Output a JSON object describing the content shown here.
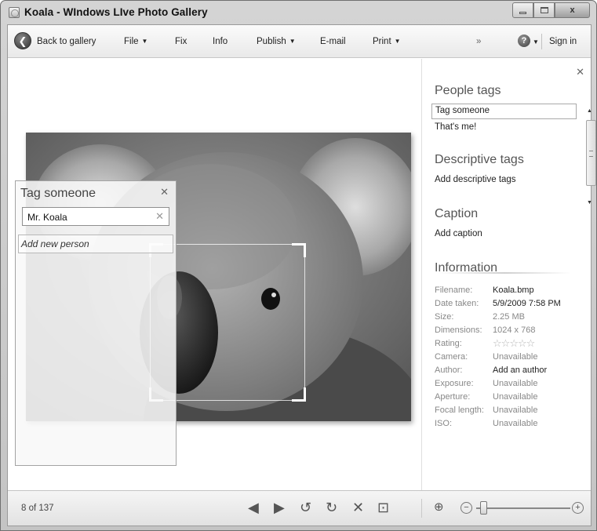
{
  "window": {
    "title": "Koala - WIndows LIve Photo Gallery",
    "controls": {
      "minimize": "",
      "maximize": "",
      "close": "x"
    }
  },
  "toolbar": {
    "back": "Back to gallery",
    "file": "File",
    "fix": "Fix",
    "info": "Info",
    "publish": "Publish",
    "email": "E-mail",
    "print": "Print",
    "more": "»",
    "help_icon": "help-icon",
    "sign_in": "Sign in"
  },
  "tag_popup": {
    "title": "Tag someone",
    "input_value": "Mr. Koala",
    "suggestion": "Add new person"
  },
  "side_pane": {
    "people_tags": {
      "title": "People tags",
      "field": "Tag someone",
      "thats_me": "That's me!"
    },
    "descriptive_tags": {
      "title": "Descriptive tags",
      "add": "Add descriptive tags"
    },
    "caption": {
      "title": "Caption",
      "add": "Add caption"
    },
    "information": {
      "title": "Information",
      "rows": [
        {
          "label": "Filename:",
          "value": "Koala.bmp",
          "strong": true
        },
        {
          "label": "Date taken:",
          "value": "5/9/2009 7:58 PM",
          "strong": true
        },
        {
          "label": "Size:",
          "value": "2.25 MB"
        },
        {
          "label": "Dimensions:",
          "value": "1024 x 768"
        },
        {
          "label": "Rating:",
          "value": ""
        },
        {
          "label": "Camera:",
          "value": "Unavailable"
        },
        {
          "label": "Author:",
          "value": "Add an author",
          "strong": true
        },
        {
          "label": "Exposure:",
          "value": "Unavailable"
        },
        {
          "label": "Aperture:",
          "value": "Unavailable"
        },
        {
          "label": "Focal length:",
          "value": "Unavailable"
        },
        {
          "label": "ISO:",
          "value": "Unavailable"
        }
      ],
      "rating_stars": 0
    }
  },
  "bottombar": {
    "counter": "8 of 137",
    "zoom_level": 0.04
  },
  "colors": {
    "frame": "#c9c9c9",
    "accent_text": "#555555"
  }
}
